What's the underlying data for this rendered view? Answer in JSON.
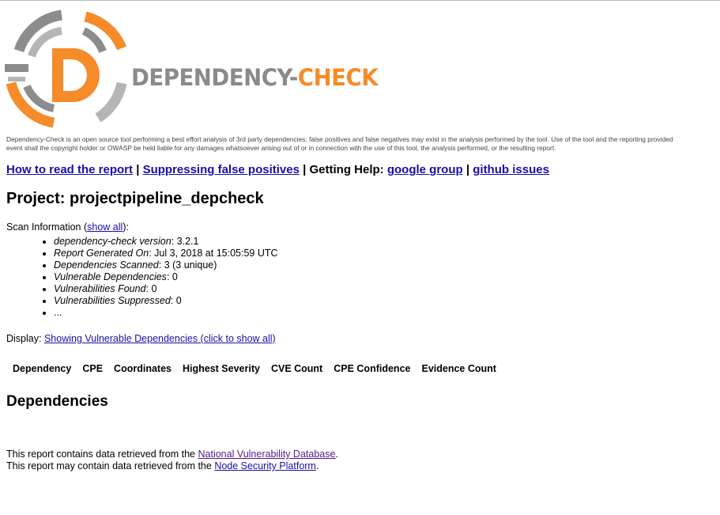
{
  "header": {
    "wordmark_part1": "DEPENDENCY-",
    "wordmark_part2": "CHECK",
    "disclaimer_line1": "Dependency-Check is an open source tool performing a best effort analysis of 3rd party dependencies; false positives and false negatives may exist in the analysis performed by the tool. Use of the tool and the reporting provided",
    "disclaimer_line2": "event shall the copyright holder or OWASP be held liable for any damages whatsoever arising out of or in connection with the use of this tool, the analysis performed, or the resulting report."
  },
  "help_links": {
    "how_to_read": "How to read the report",
    "sep1": "|",
    "suppressing": "Suppressing false positives",
    "sep2": "|",
    "getting_help": "Getting Help:",
    "google_group": "google group",
    "sep3": "|",
    "github_issues": "github issues"
  },
  "project": {
    "title": "Project: projectpipeline_depcheck"
  },
  "scan_info": {
    "label": "Scan Information (",
    "show_all": "show all",
    "label_end": "):",
    "items": [
      {
        "key": "dependency-check version",
        "value": ": 3.2.1"
      },
      {
        "key": "Report Generated On",
        "value": ": Jul 3, 2018 at 15:05:59 UTC"
      },
      {
        "key": "Dependencies Scanned",
        "value": ": 3 (3 unique)"
      },
      {
        "key": "Vulnerable Dependencies",
        "value": ": 0"
      },
      {
        "key": "Vulnerabilities Found",
        "value": ": 0"
      },
      {
        "key": "Vulnerabilities Suppressed",
        "value": ": 0"
      },
      {
        "key": "",
        "value": "..."
      }
    ]
  },
  "display": {
    "label": "Display:",
    "link": "Showing Vulnerable Dependencies (click to show all)"
  },
  "table": {
    "headers": [
      "Dependency",
      "CPE",
      "Coordinates",
      "Highest Severity",
      "CVE Count",
      "CPE Confidence",
      "Evidence Count"
    ]
  },
  "dependencies_heading": "Dependencies",
  "footer": {
    "line1_prefix": "This report contains data retrieved from the",
    "line1_link": "National Vulnerability Database",
    "line1_suffix": ".",
    "line2_prefix": "This report may contain data retrieved from the",
    "line2_link": "Node Security Platform",
    "line2_suffix": "."
  },
  "colors": {
    "brand_orange": "#f68b2a",
    "brand_gray": "#8a8a8a",
    "link_blue": "#1a0dab",
    "link_visited": "#551a8b"
  }
}
